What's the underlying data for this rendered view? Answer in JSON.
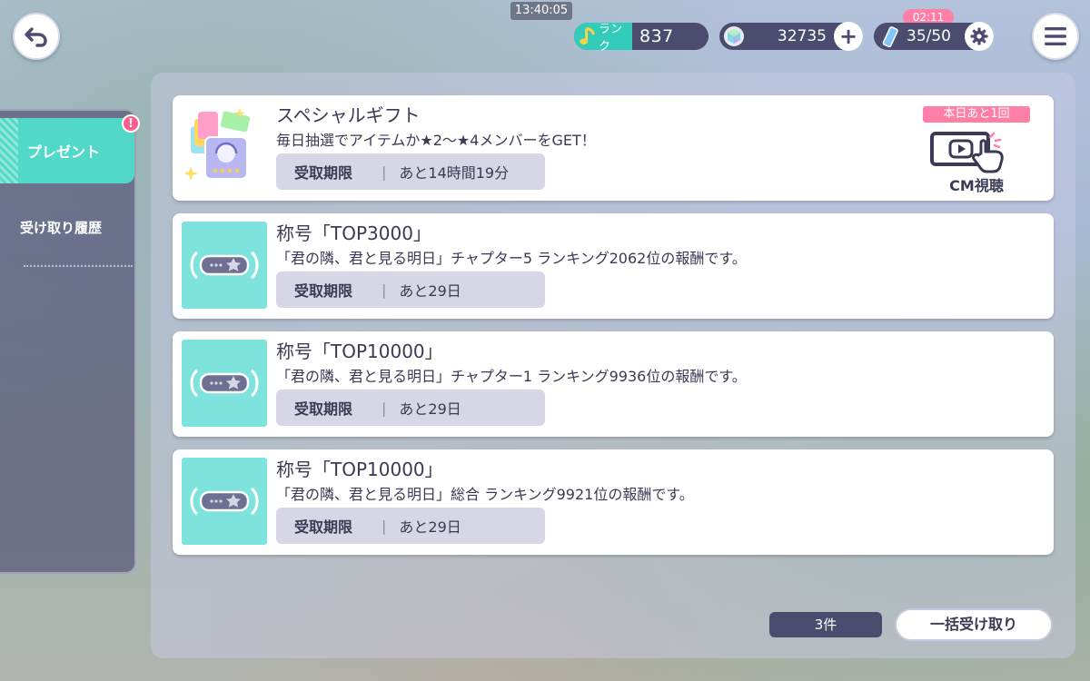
{
  "status_bar": {
    "clock": "13:40:05"
  },
  "header": {
    "rank_label": "ランク",
    "rank_value": "837",
    "gems": "32735",
    "energy": "35/50",
    "energy_timer": "02:11",
    "icons": [
      "back-arrow-icon",
      "music-note-icon",
      "crystal-icon",
      "plus-icon",
      "energy-drink-icon",
      "gear-icon",
      "menu-icon"
    ]
  },
  "sidebar": {
    "items": [
      {
        "label": "プレゼント",
        "active": true,
        "alert": "!"
      },
      {
        "label": "受け取り履歴",
        "active": false
      }
    ]
  },
  "presents": [
    {
      "title": "スペシャルギフト",
      "desc": "毎日抽選でアイテムか★2〜★4メンバーをGET！",
      "deadline_label": "受取期限",
      "deadline_sep": "|",
      "deadline_value": "あと14時間19分",
      "cm_badge": "本日あと1回",
      "cm_label": "CM視聴"
    },
    {
      "title": "称号「TOP3000」",
      "desc": "「君の隣、君と見る明日」チャプター5 ランキング2062位の報酬です。",
      "deadline_label": "受取期限",
      "deadline_sep": "|",
      "deadline_value": "あと29日"
    },
    {
      "title": "称号「TOP10000」",
      "desc": "「君の隣、君と見る明日」チャプター1 ランキング9936位の報酬です。",
      "deadline_label": "受取期限",
      "deadline_sep": "|",
      "deadline_value": "あと29日"
    },
    {
      "title": "称号「TOP10000」",
      "desc": "「君の隣、君と見る明日」総合 ランキング9921位の報酬です。",
      "deadline_label": "受取期限",
      "deadline_sep": "|",
      "deadline_value": "あと29日"
    }
  ],
  "footer": {
    "count": "3件",
    "claim_all": "一括受け取り"
  },
  "colors": {
    "accent_teal": "#52d8c8",
    "thumb_teal": "#7fe3dd",
    "pink": "#ff7fa6",
    "navy": "#4b4c6e"
  }
}
